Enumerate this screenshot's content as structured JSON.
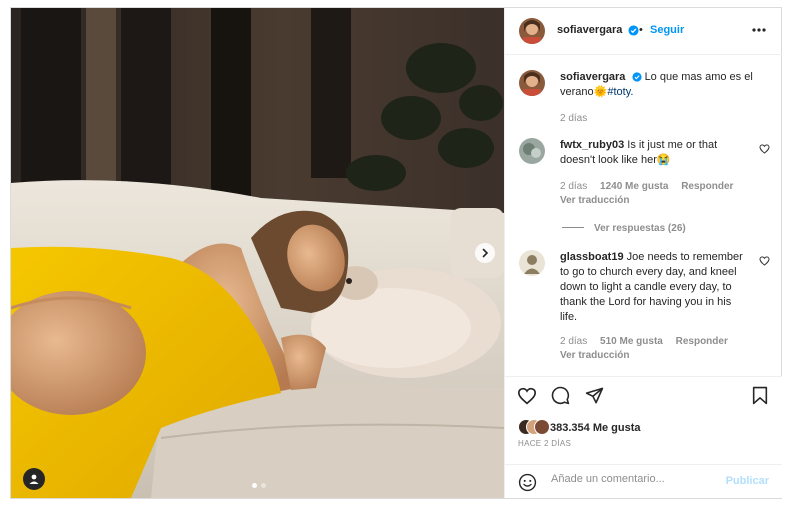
{
  "post": {
    "username": "sofiavergara",
    "follow_label": "Seguir",
    "separator": "•",
    "caption": {
      "username": "sofiavergara",
      "text": "Lo que mas amo es el verano",
      "emoji": "🌞",
      "hashtag": "#toty.",
      "time": "2 días"
    }
  },
  "comments": [
    {
      "username": "fwtx_ruby03",
      "text": "Is it just me or that doesn't look like her😭",
      "time": "2 días",
      "likes": "1240 Me gusta",
      "reply": "Responder",
      "translate": "Ver traducción",
      "view_replies": "Ver respuestas (26)"
    },
    {
      "username": "glassboat19",
      "text": "Joe needs to remember to go to church every day, and kneel down to light a candle every day, to thank the Lord for having you in his life.",
      "time": "2 días",
      "likes": "510 Me gusta",
      "reply": "Responder",
      "translate": "Ver traducción"
    }
  ],
  "actions": {
    "likes": "383.354 Me gusta",
    "time_ago": "HACE 2 DÍAS",
    "comment_placeholder": "Añade un comentario...",
    "publish_label": "Publicar"
  },
  "icons": {
    "more": "more-options-icon",
    "verified": "verified-badge-icon",
    "like": "heart-icon",
    "comment": "comment-icon",
    "share": "send-icon",
    "save": "bookmark-icon",
    "emoji": "emoji-icon",
    "next": "chevron-right-icon",
    "tag": "user-tag-icon"
  },
  "colors": {
    "accent": "#0095f6",
    "verified": "#0095f6",
    "muted": "#8e8e8e",
    "publish_disabled": "#b2dffc"
  },
  "carousel": {
    "total": 2,
    "current": 1
  }
}
